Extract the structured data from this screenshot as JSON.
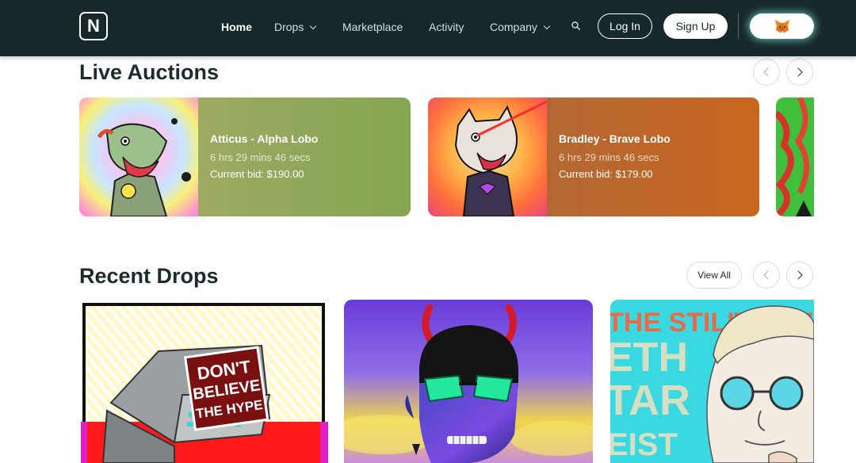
{
  "nav": {
    "logo_letter": "N",
    "links": [
      "Home",
      "Drops",
      "Marketplace",
      "Activity",
      "Company"
    ],
    "login_label": "Log In",
    "signup_label": "Sign Up",
    "wallet_icon": "fox-icon"
  },
  "live_auctions": {
    "title": "Live Auctions",
    "cards": [
      {
        "name": "Atticus - Alpha Lobo",
        "time_left": "6 hrs 29 mins 46 secs",
        "current_bid": "Current bid: $190.00",
        "color": "#8ba85a"
      },
      {
        "name": "Bradley - Brave Lobo",
        "time_left": "6 hrs 29 mins 46 secs",
        "current_bid": "Current bid: $179.00",
        "color": "#c2692b"
      }
    ]
  },
  "recent_drops": {
    "title": "Recent Drops",
    "view_all_label": "View All",
    "art_texts": {
      "hype_line1": "DON'T",
      "hype_line2": "BELIEVE",
      "hype_line3": "THE HYPE",
      "poster_text": "THE STILITY OF THE ART IS THE"
    }
  }
}
